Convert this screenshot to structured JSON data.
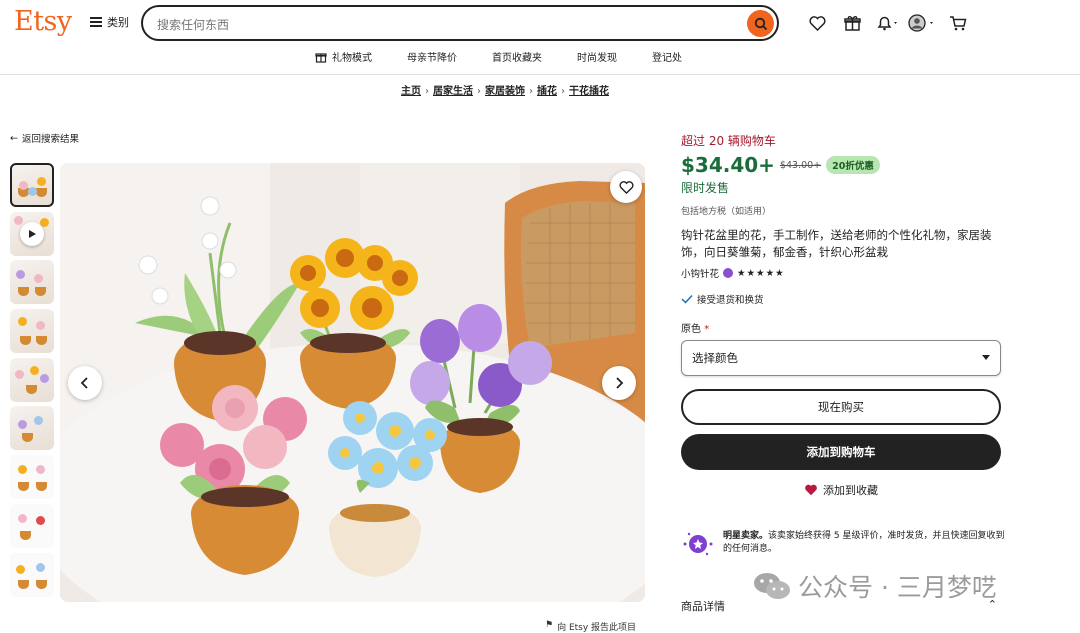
{
  "header": {
    "logo": "Etsy",
    "categories_label": "类别",
    "search_placeholder": "搜索任何东西",
    "subnav": [
      {
        "label": "礼物模式",
        "icon": "gift-icon"
      },
      {
        "label": "母亲节降价"
      },
      {
        "label": "首页收藏夹"
      },
      {
        "label": "时尚发现"
      },
      {
        "label": "登记处"
      }
    ]
  },
  "breadcrumb": [
    "主页",
    "居家生活",
    "家居装饰",
    "插花",
    "干花插花"
  ],
  "back_label": "返回搜索结果",
  "product": {
    "cart_note": "超过 20 辆购物车",
    "price": "$34.40+",
    "old_price": "$43.00+",
    "discount": "20折优惠",
    "sale_label": "限时发售",
    "tax_note": "包括地方税（如适用）",
    "title": "钩针花盆里的花，手工制作，送给老师的个性化礼物，家居装饰，向日葵雏菊，郁金香，针织心形盆栽",
    "shop_name": "小钩针花",
    "stars": "★★★★★",
    "returns": "接受退货和换货",
    "color_label": "原色",
    "color_required": "*",
    "select_placeholder": "选择颜色",
    "buy_now": "现在购买",
    "add_to_cart": "添加到购物车",
    "add_favorite": "添加到收藏"
  },
  "star_seller": {
    "title": "明星卖家。",
    "text": "该卖家始终获得 5 星级评价，准时发货，并且快速回复收到的任何消息。"
  },
  "details_label": "商品详情",
  "report_label": "向 Etsy 报告此项目",
  "watermark": "公众号 · 三月梦呓",
  "colors": {
    "brand": "#f1641e",
    "price": "#1b6d3a",
    "cart_note": "#a61a2e",
    "discount_bg": "#b8e6b3"
  }
}
